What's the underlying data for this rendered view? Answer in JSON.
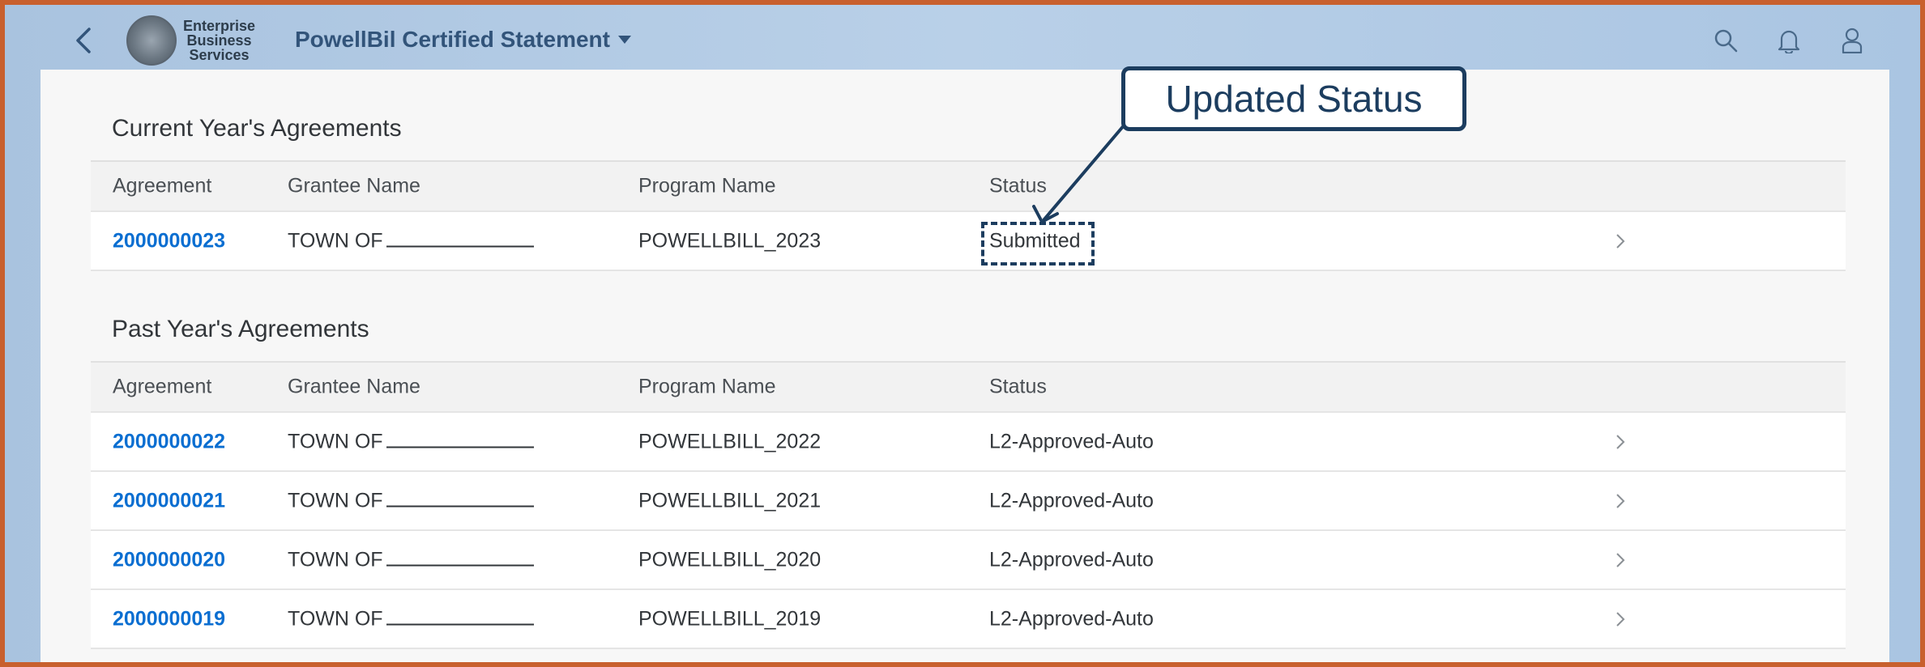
{
  "shell": {
    "logo_lines": [
      "Enterprise",
      "Business",
      "Services"
    ],
    "app_title": "PowellBil Certified Statement"
  },
  "current": {
    "title": "Current Year's Agreements",
    "headers": [
      "Agreement",
      "Grantee Name",
      "Program Name",
      "Status"
    ],
    "rows": [
      {
        "agreement": "2000000023",
        "grantee": "TOWN OF",
        "program": "POWELLBILL_2023",
        "status": "Submitted"
      }
    ]
  },
  "past": {
    "title": "Past Year's Agreements",
    "headers": [
      "Agreement",
      "Grantee Name",
      "Program Name",
      "Status"
    ],
    "rows": [
      {
        "agreement": "2000000022",
        "grantee": "TOWN OF",
        "program": "POWELLBILL_2022",
        "status": "L2-Approved-Auto"
      },
      {
        "agreement": "2000000021",
        "grantee": "TOWN OF",
        "program": "POWELLBILL_2021",
        "status": "L2-Approved-Auto"
      },
      {
        "agreement": "2000000020",
        "grantee": "TOWN OF",
        "program": "POWELLBILL_2020",
        "status": "L2-Approved-Auto"
      },
      {
        "agreement": "2000000019",
        "grantee": "TOWN OF",
        "program": "POWELLBILL_2019",
        "status": "L2-Approved-Auto"
      }
    ]
  },
  "annotation": {
    "callout_text": "Updated Status"
  },
  "colors": {
    "accent_link": "#0a6ed1",
    "annotation": "#1c3d5f",
    "frame_border": "#c8602e"
  }
}
